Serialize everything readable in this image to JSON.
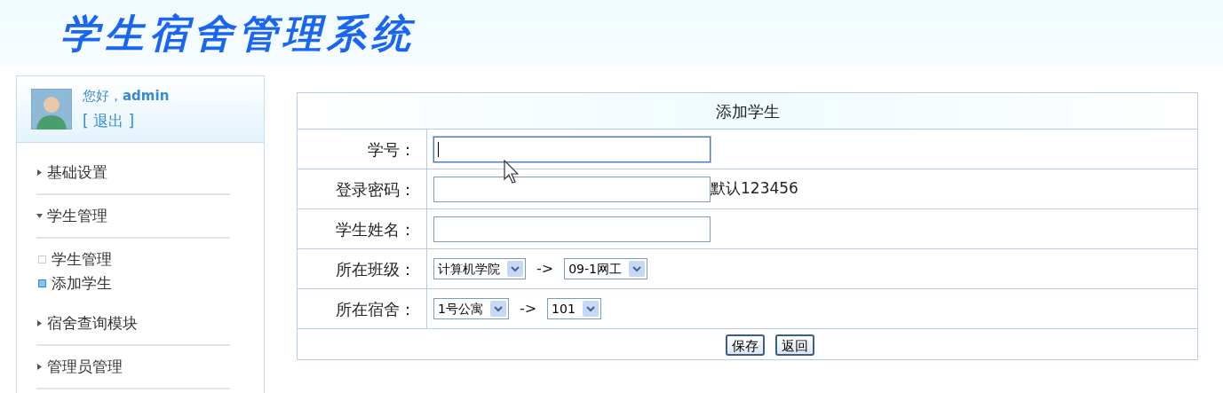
{
  "header": {
    "title": "学生宿舍管理系统"
  },
  "user": {
    "greeting": "您好，",
    "name": "admin",
    "logout": "[ 退出 ]"
  },
  "menu": [
    {
      "label": "基础设置",
      "expanded": false
    },
    {
      "label": "学生管理",
      "expanded": true,
      "children": [
        {
          "label": "学生管理",
          "selected": false
        },
        {
          "label": "添加学生",
          "selected": true
        }
      ]
    },
    {
      "label": "宿舍查询模块",
      "expanded": false
    },
    {
      "label": "管理员管理",
      "expanded": false
    }
  ],
  "form": {
    "title": "添加学生",
    "rows": [
      {
        "kind": "text",
        "label": "学号：",
        "focused": true
      },
      {
        "kind": "text",
        "label": "登录密码：",
        "focused": false,
        "hint": "默认123456"
      },
      {
        "kind": "text",
        "label": "学生姓名：",
        "focused": false
      },
      {
        "kind": "select-pair",
        "label": "所在班级：",
        "first": "计算机学院",
        "arrow": "->",
        "second": "09-1网工"
      },
      {
        "kind": "select-pair",
        "label": "所在宿舍：",
        "first": "1号公寓",
        "arrow": "->",
        "second": "101"
      }
    ],
    "buttons": [
      "保存",
      "返回"
    ]
  }
}
